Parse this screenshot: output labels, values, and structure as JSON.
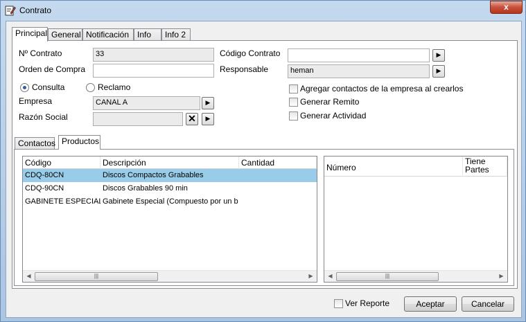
{
  "window": {
    "title": "Contrato",
    "close_label": "x"
  },
  "main_tabs": [
    {
      "label": "Principal"
    },
    {
      "label": "General"
    },
    {
      "label": "Notificación"
    },
    {
      "label": "Info"
    },
    {
      "label": "Info 2"
    }
  ],
  "form": {
    "nro_contrato_label": "Nº Contrato",
    "nro_contrato_value": "33",
    "orden_compra_label": "Orden de Compra",
    "orden_compra_value": "",
    "tipo_consulta_label": "Consulta",
    "tipo_reclamo_label": "Reclamo",
    "tipo_selected": "Consulta",
    "empresa_label": "Empresa",
    "empresa_value": "CANAL A",
    "razon_social_label": "Razón Social",
    "razon_social_value": "",
    "codigo_contrato_label": "Código Contrato",
    "codigo_contrato_value": "",
    "responsable_label": "Responsable",
    "responsable_value": "heman",
    "agregar_contactos_label": "Agregar contactos de la empresa al crearlos",
    "generar_remito_label": "Generar Remito",
    "generar_actividad_label": "Generar Actividad"
  },
  "sub_tabs": [
    {
      "label": "Contactos"
    },
    {
      "label": "Productos"
    }
  ],
  "productos_grid": {
    "columns": [
      "Código",
      "Descripción",
      "Cantidad"
    ],
    "rows": [
      {
        "codigo": "CDQ-80CN",
        "descripcion": "Discos Compactos Grabables",
        "cantidad": ""
      },
      {
        "codigo": "CDQ-90CN",
        "descripcion": "Discos Grabables 90 min",
        "cantidad": ""
      },
      {
        "codigo": "GABINETE ESPECIAL",
        "descripcion": "Gabinete Especial (Compuesto por un b",
        "cantidad": ""
      }
    ],
    "selected_row": 0
  },
  "partes_grid": {
    "columns": [
      "Número",
      "Tiene Partes"
    ]
  },
  "footer": {
    "ver_reporte_label": "Ver Reporte",
    "aceptar_label": "Aceptar",
    "cancelar_label": "Cancelar"
  },
  "colors": {
    "selection": "#98cce8",
    "titlebar": "#c4d9ee",
    "close": "#c7503a"
  },
  "icons": {
    "window": "edit-document-icon",
    "lookup": "arrow-right-icon",
    "clear": "x-icon"
  }
}
